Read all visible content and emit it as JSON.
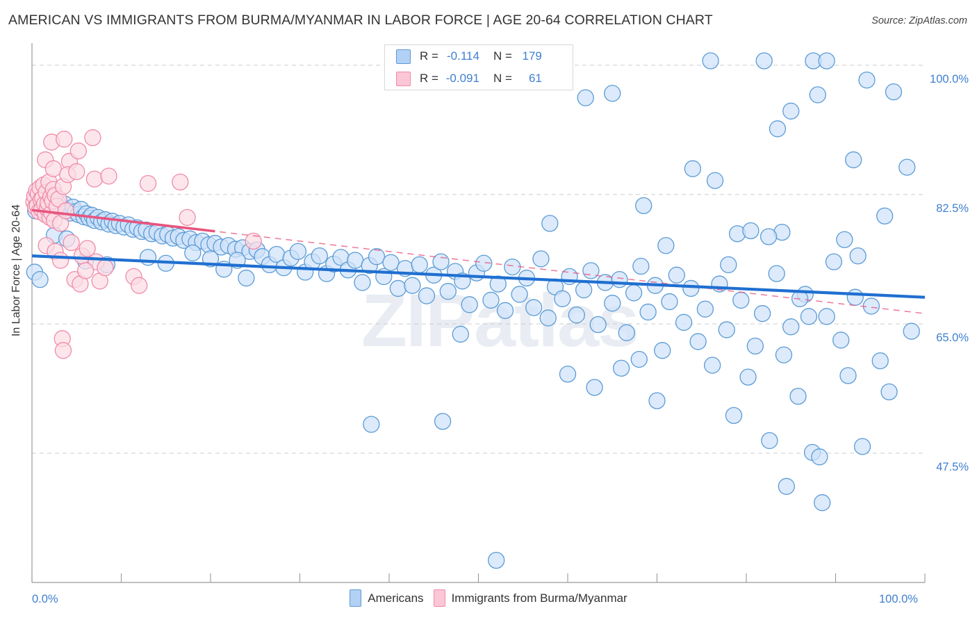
{
  "header": {
    "title": "AMERICAN VS IMMIGRANTS FROM BURMA/MYANMAR IN LABOR FORCE | AGE 20-64 CORRELATION CHART",
    "source": "Source: ZipAtlas.com"
  },
  "watermark": "ZIPatlas",
  "stats": {
    "rows": [
      {
        "series": "Americans",
        "r_label": "R =",
        "r_value": "-0.114",
        "n_label": "N =",
        "n_value": "179",
        "color": "#b3d0f5"
      },
      {
        "series": "Immigrants from Burma/Myanmar",
        "r_label": "R =",
        "r_value": "-0.091",
        "n_label": "N =",
        "n_value": "61",
        "color": "#fbc6d6"
      }
    ]
  },
  "legend": {
    "items": [
      {
        "label": "Americans",
        "color": "#b3d0f5",
        "border": "#5b9bd5"
      },
      {
        "label": "Immigrants from Burma/Myanmar",
        "color": "#fbc6d6",
        "border": "#f08aa8"
      }
    ]
  },
  "chart_data": {
    "type": "scatter",
    "title": "AMERICAN VS IMMIGRANTS FROM BURMA/MYANMAR IN LABOR FORCE | AGE 20-64 CORRELATION CHART",
    "xlabel": "",
    "ylabel": "In Labor Force | Age 20-64",
    "xlim": [
      0,
      100
    ],
    "ylim": [
      30.0,
      103.0
    ],
    "grid": true,
    "x_ticks": [
      "0.0%",
      "100.0%"
    ],
    "x_tick_values": [
      0,
      100
    ],
    "y_ticks": [
      "100.0%",
      "82.5%",
      "65.0%",
      "47.5%"
    ],
    "y_tick_values": [
      100.0,
      82.5,
      65.0,
      47.5
    ],
    "legend_position": "bottom-center",
    "series": [
      {
        "name": "Americans",
        "color": "#cfe2fa",
        "border": "#5b9bd5",
        "r": -0.114,
        "n": 179,
        "trendline": {
          "style": "solid",
          "color": "#1f6fd0",
          "x0": 0,
          "y0": 74.2,
          "x1": 100,
          "y1": 68.6
        },
        "points": [
          [
            0.3,
            72.0
          ],
          [
            0.4,
            80.3
          ],
          [
            0.6,
            81.5
          ],
          [
            1.0,
            81.8
          ],
          [
            1.3,
            81.0
          ],
          [
            1.6,
            81.7
          ],
          [
            1.9,
            82.2
          ],
          [
            2.2,
            81.3
          ],
          [
            2.5,
            80.9
          ],
          [
            2.8,
            81.6
          ],
          [
            3.1,
            81.1
          ],
          [
            3.4,
            80.6
          ],
          [
            3.7,
            81.2
          ],
          [
            4.0,
            80.4
          ],
          [
            4.3,
            80.0
          ],
          [
            4.6,
            80.8
          ],
          [
            4.9,
            80.2
          ],
          [
            5.2,
            79.8
          ],
          [
            5.5,
            80.5
          ],
          [
            5.8,
            79.5
          ],
          [
            6.1,
            79.9
          ],
          [
            6.4,
            79.3
          ],
          [
            6.7,
            79.7
          ],
          [
            7.0,
            79.0
          ],
          [
            7.4,
            79.4
          ],
          [
            7.8,
            78.8
          ],
          [
            8.2,
            79.1
          ],
          [
            8.6,
            78.5
          ],
          [
            9.0,
            78.9
          ],
          [
            9.4,
            78.3
          ],
          [
            9.8,
            78.6
          ],
          [
            10.3,
            78.1
          ],
          [
            10.8,
            78.4
          ],
          [
            11.3,
            77.8
          ],
          [
            11.8,
            78.0
          ],
          [
            12.3,
            77.5
          ],
          [
            12.8,
            77.7
          ],
          [
            13.4,
            77.2
          ],
          [
            14.0,
            77.4
          ],
          [
            14.6,
            76.9
          ],
          [
            15.2,
            77.1
          ],
          [
            15.8,
            76.6
          ],
          [
            16.4,
            76.8
          ],
          [
            17.0,
            76.3
          ],
          [
            17.7,
            76.5
          ],
          [
            18.4,
            76.0
          ],
          [
            19.1,
            76.2
          ],
          [
            19.8,
            75.7
          ],
          [
            20.5,
            75.9
          ],
          [
            21.2,
            75.4
          ],
          [
            22.0,
            75.6
          ],
          [
            22.8,
            75.1
          ],
          [
            23.6,
            75.3
          ],
          [
            24.4,
            74.8
          ],
          [
            25.2,
            75.0
          ],
          [
            2.5,
            77.0
          ],
          [
            3.9,
            76.5
          ],
          [
            6.0,
            73.5
          ],
          [
            0.9,
            71.0
          ],
          [
            8.4,
            73.0
          ],
          [
            13.0,
            74.0
          ],
          [
            15.0,
            73.2
          ],
          [
            18.0,
            74.6
          ],
          [
            20.0,
            73.8
          ],
          [
            21.5,
            72.4
          ],
          [
            23.0,
            73.6
          ],
          [
            24.0,
            71.2
          ],
          [
            25.8,
            74.1
          ],
          [
            26.6,
            73.0
          ],
          [
            27.4,
            74.4
          ],
          [
            28.2,
            72.6
          ],
          [
            29.0,
            73.9
          ],
          [
            29.8,
            74.8
          ],
          [
            30.6,
            72.0
          ],
          [
            31.4,
            73.4
          ],
          [
            32.2,
            74.2
          ],
          [
            33.0,
            71.8
          ],
          [
            33.8,
            73.1
          ],
          [
            34.6,
            74.0
          ],
          [
            35.4,
            72.3
          ],
          [
            36.2,
            73.6
          ],
          [
            37.0,
            70.6
          ],
          [
            37.8,
            72.9
          ],
          [
            38.6,
            74.1
          ],
          [
            39.4,
            71.4
          ],
          [
            40.2,
            73.3
          ],
          [
            41.0,
            69.8
          ],
          [
            41.8,
            72.5
          ],
          [
            42.6,
            70.2
          ],
          [
            43.4,
            73.0
          ],
          [
            44.2,
            68.8
          ],
          [
            45.0,
            71.6
          ],
          [
            45.8,
            73.4
          ],
          [
            46.6,
            69.4
          ],
          [
            47.4,
            72.1
          ],
          [
            48.2,
            70.8
          ],
          [
            49.0,
            67.6
          ],
          [
            49.8,
            71.9
          ],
          [
            50.6,
            73.2
          ],
          [
            51.4,
            68.2
          ],
          [
            52.2,
            70.4
          ],
          [
            53.0,
            66.8
          ],
          [
            53.8,
            72.7
          ],
          [
            54.6,
            69.0
          ],
          [
            55.4,
            71.2
          ],
          [
            56.2,
            67.2
          ],
          [
            57.0,
            73.8
          ],
          [
            57.8,
            65.8
          ],
          [
            58.6,
            70.0
          ],
          [
            59.4,
            68.4
          ],
          [
            60.2,
            71.4
          ],
          [
            61.0,
            66.2
          ],
          [
            61.8,
            69.6
          ],
          [
            62.6,
            72.2
          ],
          [
            63.4,
            64.9
          ],
          [
            64.2,
            70.6
          ],
          [
            65.0,
            67.8
          ],
          [
            65.8,
            71.0
          ],
          [
            66.6,
            63.8
          ],
          [
            67.4,
            69.2
          ],
          [
            68.2,
            72.8
          ],
          [
            69.0,
            66.6
          ],
          [
            69.8,
            70.2
          ],
          [
            70.6,
            61.4
          ],
          [
            71.4,
            68.0
          ],
          [
            60.0,
            58.2
          ],
          [
            63.0,
            56.4
          ],
          [
            66.0,
            59.0
          ],
          [
            68.0,
            60.2
          ],
          [
            70.0,
            54.6
          ],
          [
            72.2,
            71.6
          ],
          [
            73.0,
            65.2
          ],
          [
            73.8,
            69.8
          ],
          [
            74.6,
            62.6
          ],
          [
            75.4,
            67.0
          ],
          [
            76.2,
            59.4
          ],
          [
            77.0,
            70.4
          ],
          [
            77.8,
            64.2
          ],
          [
            78.6,
            52.6
          ],
          [
            79.4,
            68.2
          ],
          [
            80.2,
            57.8
          ],
          [
            81.0,
            62.0
          ],
          [
            81.8,
            66.4
          ],
          [
            82.6,
            49.2
          ],
          [
            83.4,
            71.8
          ],
          [
            84.2,
            60.8
          ],
          [
            85.0,
            64.6
          ],
          [
            85.8,
            55.2
          ],
          [
            86.6,
            69.0
          ],
          [
            87.4,
            47.6
          ],
          [
            88.2,
            47.0
          ],
          [
            89.0,
            66.0
          ],
          [
            89.8,
            73.4
          ],
          [
            90.6,
            62.8
          ],
          [
            91.4,
            58.0
          ],
          [
            92.2,
            68.6
          ],
          [
            93.0,
            48.4
          ],
          [
            94.0,
            67.4
          ],
          [
            95.0,
            60.0
          ],
          [
            96.0,
            55.8
          ],
          [
            46.0,
            51.8
          ],
          [
            52.0,
            33.0
          ],
          [
            74.0,
            86.0
          ],
          [
            62.0,
            95.6
          ],
          [
            65.0,
            96.2
          ],
          [
            76.0,
            100.6
          ],
          [
            82.0,
            100.6
          ],
          [
            87.5,
            100.6
          ],
          [
            89.0,
            100.6
          ],
          [
            76.5,
            84.4
          ],
          [
            83.5,
            91.4
          ],
          [
            85.0,
            93.8
          ],
          [
            88.0,
            96.0
          ],
          [
            92.0,
            87.2
          ],
          [
            93.5,
            98.0
          ],
          [
            95.5,
            79.6
          ],
          [
            96.5,
            96.4
          ],
          [
            98.0,
            86.2
          ],
          [
            98.5,
            64.0
          ],
          [
            91.0,
            76.4
          ],
          [
            92.5,
            74.2
          ],
          [
            84.0,
            77.4
          ],
          [
            79.0,
            77.2
          ],
          [
            80.5,
            77.6
          ],
          [
            86.0,
            68.4
          ],
          [
            87.0,
            66.0
          ],
          [
            82.5,
            76.8
          ],
          [
            78.0,
            73.0
          ],
          [
            71.0,
            75.6
          ],
          [
            58.0,
            78.6
          ],
          [
            68.5,
            81.0
          ],
          [
            48.0,
            63.6
          ],
          [
            84.5,
            43.0
          ],
          [
            88.5,
            40.8
          ],
          [
            38.0,
            51.4
          ]
        ]
      },
      {
        "name": "Immigrants from Burma/Myanmar",
        "color": "#fbdce5",
        "border": "#f08aa8",
        "r": -0.091,
        "n": 61,
        "trendline": {
          "style": "solid-then-dashed",
          "color": "#e8547e",
          "x0": 0,
          "y0": 80.4,
          "x1": 100,
          "y1": 66.4,
          "solid_until": 20.5
        },
        "points": [
          [
            0.2,
            81.5
          ],
          [
            0.3,
            82.3
          ],
          [
            0.4,
            80.8
          ],
          [
            0.5,
            83.0
          ],
          [
            0.6,
            81.0
          ],
          [
            0.7,
            82.6
          ],
          [
            0.8,
            80.2
          ],
          [
            0.9,
            83.4
          ],
          [
            1.0,
            81.8
          ],
          [
            1.1,
            80.5
          ],
          [
            1.2,
            82.0
          ],
          [
            1.3,
            83.8
          ],
          [
            1.4,
            81.2
          ],
          [
            1.5,
            79.8
          ],
          [
            1.6,
            82.8
          ],
          [
            1.7,
            80.6
          ],
          [
            1.8,
            81.4
          ],
          [
            1.9,
            84.2
          ],
          [
            2.0,
            79.4
          ],
          [
            2.1,
            82.2
          ],
          [
            2.2,
            80.0
          ],
          [
            2.3,
            81.6
          ],
          [
            2.4,
            83.2
          ],
          [
            2.5,
            79.0
          ],
          [
            2.6,
            82.4
          ],
          [
            2.8,
            80.9
          ],
          [
            3.0,
            81.9
          ],
          [
            3.2,
            78.6
          ],
          [
            3.5,
            83.6
          ],
          [
            3.8,
            80.3
          ],
          [
            1.5,
            87.2
          ],
          [
            2.2,
            89.6
          ],
          [
            2.4,
            86.0
          ],
          [
            3.6,
            90.0
          ],
          [
            4.2,
            87.0
          ],
          [
            5.2,
            88.4
          ],
          [
            6.8,
            90.2
          ],
          [
            4.0,
            85.2
          ],
          [
            5.0,
            85.6
          ],
          [
            7.0,
            84.6
          ],
          [
            8.6,
            85.0
          ],
          [
            13.0,
            84.0
          ],
          [
            16.6,
            84.2
          ],
          [
            1.6,
            75.6
          ],
          [
            2.6,
            74.8
          ],
          [
            3.2,
            73.6
          ],
          [
            4.4,
            76.0
          ],
          [
            5.6,
            74.2
          ],
          [
            6.2,
            75.2
          ],
          [
            7.2,
            73.4
          ],
          [
            4.8,
            71.0
          ],
          [
            5.4,
            70.4
          ],
          [
            6.0,
            72.2
          ],
          [
            7.6,
            70.8
          ],
          [
            8.2,
            72.6
          ],
          [
            11.4,
            71.4
          ],
          [
            12.0,
            70.2
          ],
          [
            17.4,
            79.4
          ],
          [
            24.8,
            76.2
          ],
          [
            3.4,
            63.0
          ],
          [
            3.5,
            61.4
          ]
        ]
      }
    ]
  }
}
